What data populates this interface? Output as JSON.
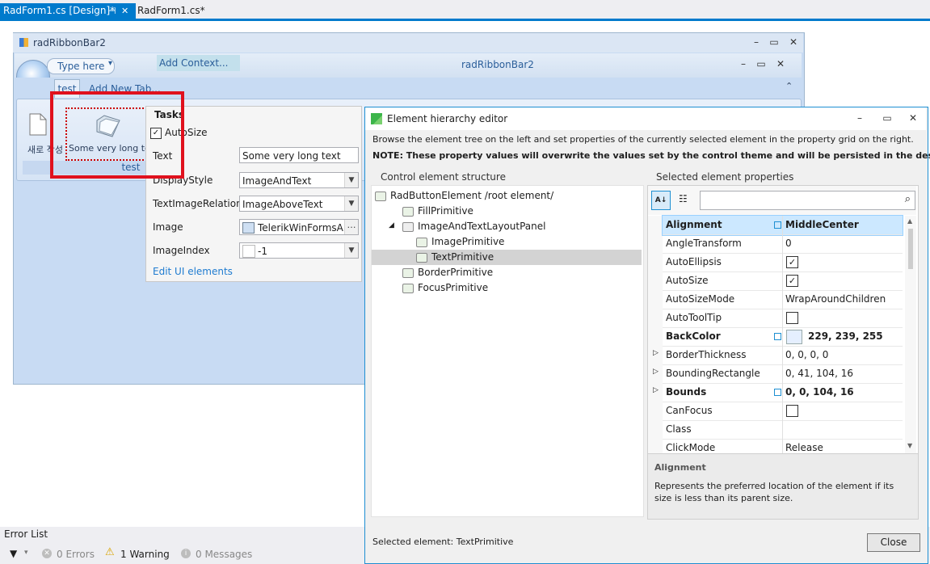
{
  "tabs": [
    {
      "label": "RadForm1.cs [Design]*",
      "active": true
    },
    {
      "label": "RadForm1.cs*",
      "active": false
    }
  ],
  "colors": {
    "accent": "#007acc",
    "highlight": "#e0111d",
    "ribbon": "#c8dbf3"
  },
  "form": {
    "title": "radRibbonBar2",
    "qat_text": "Type here",
    "add_context": "Add Context...",
    "ribbon_caption": "radRibbonBar2",
    "tab_label": "test",
    "add_tab": "Add New Tab...",
    "group_label": "test",
    "new_button_label": "새로 작성",
    "button_label": "Some very long text"
  },
  "smart_tag": {
    "title": "Tasks",
    "autosize_label": "AutoSize",
    "autosize_checked": true,
    "text_label": "Text",
    "text_value": "Some very long text",
    "display_style_label": "DisplayStyle",
    "display_style_value": "ImageAndText",
    "tir_label": "TextImageRelation",
    "tir_value": "ImageAboveText",
    "image_label": "Image",
    "image_value": "TelerikWinFormsA",
    "image_index_label": "ImageIndex",
    "image_index_value": "-1",
    "edit_link": "Edit UI elements"
  },
  "error_list": {
    "title": "Error List",
    "errors": "0 Errors",
    "warnings": "1 Warning",
    "messages": "0 Messages"
  },
  "dialog": {
    "title": "Element hierarchy editor",
    "intro": "Browse the element tree on the left and set properties of the currently selected element in the property grid on the right.",
    "note": "NOTE: These property values will overwrite the values set by the control theme and will be persisted in the designer.",
    "tree_header": "Control element structure",
    "props_header": "Selected element properties",
    "tree": [
      {
        "label": "RadButtonElement /root element/",
        "level": 0
      },
      {
        "label": "FillPrimitive",
        "level": 1
      },
      {
        "label": "ImageAndTextLayoutPanel",
        "level": 1,
        "expanded": true
      },
      {
        "label": "ImagePrimitive",
        "level": 2
      },
      {
        "label": "TextPrimitive",
        "level": 2,
        "selected": true
      },
      {
        "label": "BorderPrimitive",
        "level": 1
      },
      {
        "label": "FocusPrimitive",
        "level": 1
      }
    ],
    "properties": [
      {
        "name": "Alignment",
        "value": "MiddleCenter",
        "bold": true,
        "modified": true,
        "selected": true
      },
      {
        "name": "AngleTransform",
        "value": "0"
      },
      {
        "name": "AutoEllipsis",
        "value": "",
        "checkbox": true,
        "checked": true
      },
      {
        "name": "AutoSize",
        "value": "",
        "checkbox": true,
        "checked": true
      },
      {
        "name": "AutoSizeMode",
        "value": "WrapAroundChildren"
      },
      {
        "name": "AutoToolTip",
        "value": "",
        "checkbox": true,
        "checked": false
      },
      {
        "name": "BackColor",
        "value": "229, 239, 255",
        "bold": true,
        "modified": true,
        "swatch": true
      },
      {
        "name": "BorderThickness",
        "value": "0, 0, 0, 0",
        "expandable": true
      },
      {
        "name": "BoundingRectangle",
        "value": "0, 41, 104, 16",
        "expandable": true
      },
      {
        "name": "Bounds",
        "value": "0, 0, 104, 16",
        "bold": true,
        "modified": true,
        "expandable": true
      },
      {
        "name": "CanFocus",
        "value": "",
        "checkbox": true,
        "checked": false
      },
      {
        "name": "Class",
        "value": ""
      },
      {
        "name": "ClickMode",
        "value": "Release"
      }
    ],
    "desc_title": "Alignment",
    "desc_text": "Represents the preferred location of the element if its size is less than its parent size.",
    "selected_element": "Selected element: TextPrimitive",
    "close_label": "Close"
  }
}
